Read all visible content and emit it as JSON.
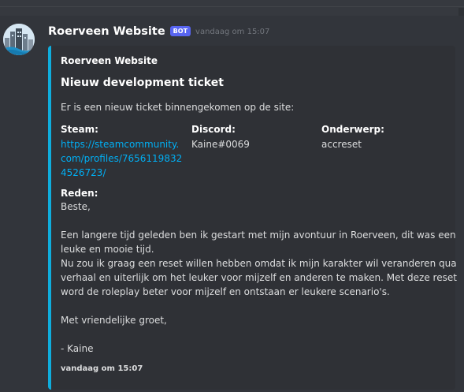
{
  "message": {
    "username": "Roerveen Website",
    "bot_tag": "BOT",
    "timestamp": "vandaag om 15:07",
    "avatar_icon": "city-skyline-icon"
  },
  "embed": {
    "accent_color": "#0faddd",
    "author": "Roerveen Website",
    "title": "Nieuw development ticket",
    "description": "Er is een nieuw ticket binnengekomen op de site:",
    "fields": {
      "steam": {
        "name": "Steam:",
        "value_lines": [
          "https://steamcommunity.",
          "com/profiles/7656119832",
          "4526723/"
        ]
      },
      "discord": {
        "name": "Discord:",
        "value": "Kaine#0069"
      },
      "subject": {
        "name": "Onderwerp:",
        "value": "accreset"
      },
      "reason": {
        "name": "Reden:",
        "lines": [
          "Beste,",
          "",
          "Een langere tijd geleden ben ik gestart met mijn avontuur in Roerveen, dit was een",
          "leuke en mooie tijd.",
          "Nu zou ik graag een reset willen hebben omdat ik mijn karakter wil veranderen qua",
          "verhaal en uiterlijk om het leuker voor mijzelf en anderen te maken. Met deze reset",
          "word de roleplay beter voor mijzelf en ontstaan er leukere scenario's.",
          "",
          "Met vriendelijke groet,",
          "",
          "- Kaine"
        ]
      }
    },
    "footer": "vandaag om 15:07"
  },
  "colors": {
    "background": "#36393f",
    "message_hover": "#32353b",
    "embed_background": "#2f3136",
    "link": "#00aff4",
    "bot_tag": "#5865f2"
  }
}
